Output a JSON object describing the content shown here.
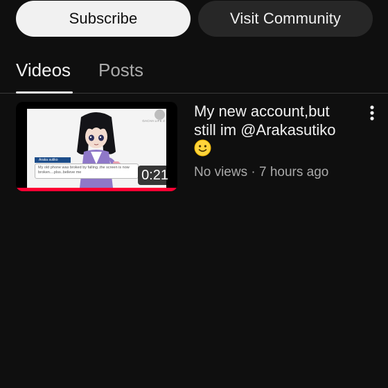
{
  "actions": {
    "subscribe_label": "Subscribe",
    "community_label": "Visit Community"
  },
  "tabs": [
    {
      "label": "Videos",
      "selected": true
    },
    {
      "label": "Posts",
      "selected": false
    }
  ],
  "videos": [
    {
      "title": "My new account,but still im @Arakasutiko",
      "title_emoji": "slightly-smiling-face-emoji",
      "views": "No views",
      "separator": "·",
      "age": "7 hours ago",
      "duration": "0:21",
      "watched_fraction": 1.0,
      "thumbnail": {
        "tag": "Araka sutiko",
        "caption": "My old phone was broked by falling..the screen is now broken....plss..believe me",
        "watermark": "GACHA LIFE 2"
      }
    }
  ],
  "menu_icon": "kebab-vertical-icon",
  "colors": {
    "background": "#0f0f0f",
    "primary_text": "#f1f1f1",
    "secondary_text": "#aaaaaa",
    "subscribe_bg": "#f1f1f1",
    "community_bg": "#272727",
    "progress": "#ff0033"
  }
}
